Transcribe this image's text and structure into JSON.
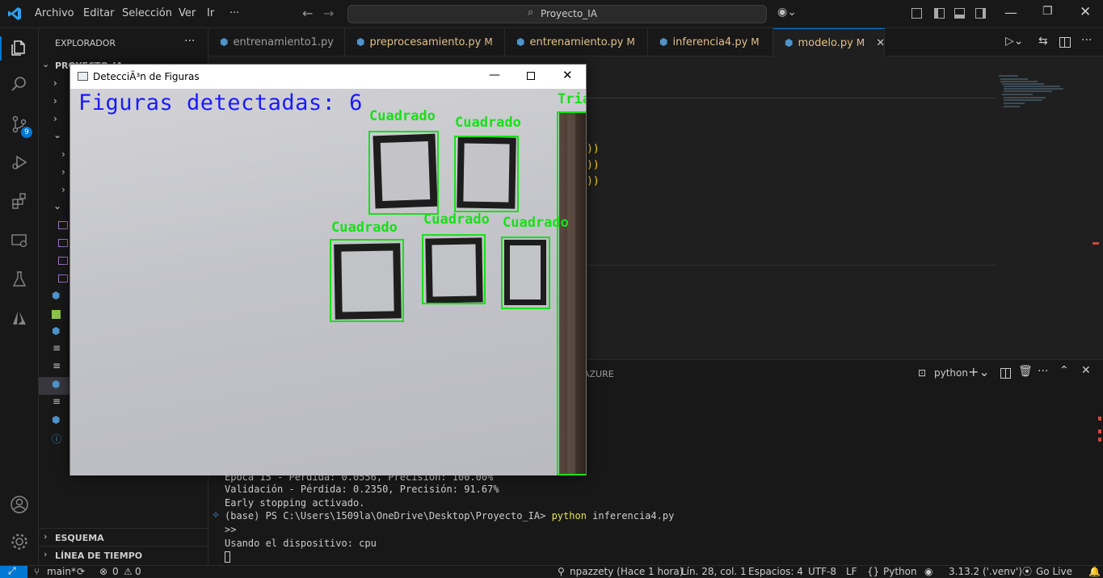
{
  "app": {
    "title": "Proyecto_IA"
  },
  "menu": [
    "Archivo",
    "Editar",
    "Selección",
    "Ver",
    "Ir",
    "···"
  ],
  "sidebar": {
    "header": "EXPLORADOR",
    "more": "···",
    "project": "PROYECTO_IA",
    "outline": "ESQUEMA",
    "timeline": "LÍNEA DE TIEMPO"
  },
  "activity": {
    "scm_badge": "9"
  },
  "tabs": [
    {
      "label": "entrenamiento1.py",
      "modified": ""
    },
    {
      "label": "preprocesamiento.py",
      "modified": "M"
    },
    {
      "label": "entrenamiento.py",
      "modified": "M"
    },
    {
      "label": "inferencia4.py",
      "modified": "M"
    },
    {
      "label": "modelo.py",
      "modified": "M"
    }
  ],
  "panel": {
    "tab_visible": "AZURE",
    "terminal_name": "python",
    "lines": [
      "Época 15 - Pérdida: 0.0556, Precisión: 100.00%",
      "Validación - Pérdida: 0.2350, Precisión: 91.67%",
      "Early stopping activado.",
      "(base) PS C:\\Users\\1509la\\OneDrive\\Desktop\\Proyecto_IA> ",
      ">>",
      "Usando el dispositivo: cpu"
    ],
    "cmd": "python",
    "cmd_arg": " inferencia4.py"
  },
  "cvwindow": {
    "title": "DetecciÃ³n de Figuras",
    "count_text": "Figuras detectadas: 6",
    "labels": [
      "Cuadrado",
      "Cuadrado",
      "Cuadrado",
      "Cuadrado",
      "Cuadrado",
      "Triangulo"
    ],
    "partial_label": "Trian"
  },
  "statusbar": {
    "branch": "main*",
    "errors": "0",
    "warnings": "0",
    "blame": "npazzety (Hace 1 hora)",
    "position": "Lín. 28, col. 1",
    "spaces": "Espacios: 4",
    "encoding": "UTF-8",
    "eol": "LF",
    "language": "Python",
    "interpreter": "3.13.2 ('.venv')",
    "golive": "Go Live"
  },
  "colors": {
    "detect_green": "#18e018",
    "count_blue": "#1a1aff",
    "accent": "#0078d4",
    "modified": "#e2c08d"
  }
}
